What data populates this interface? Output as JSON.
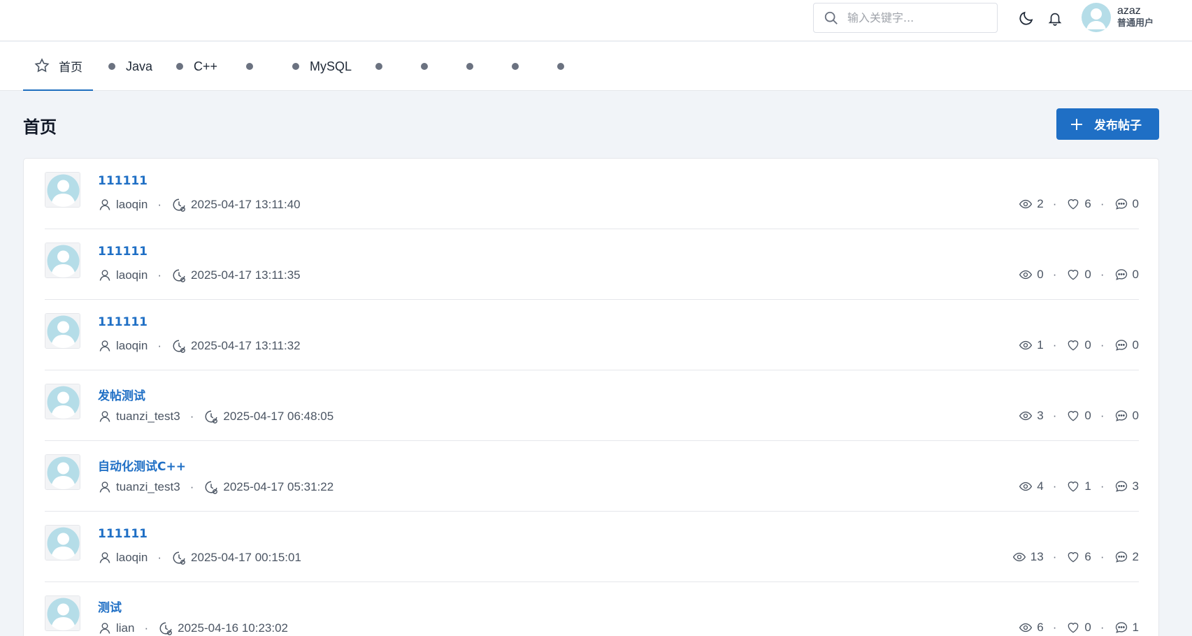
{
  "header": {
    "search_placeholder": "输入关键字...",
    "user": {
      "name": "azaz",
      "role": "普通用户"
    }
  },
  "categories": [
    {
      "label": "首页",
      "active": true
    },
    {
      "label": "Java"
    },
    {
      "label": "C++"
    },
    {
      "label": ""
    },
    {
      "label": "MySQL"
    },
    {
      "label": ""
    },
    {
      "label": ""
    },
    {
      "label": ""
    },
    {
      "label": ""
    },
    {
      "label": ""
    }
  ],
  "page": {
    "title": "首页",
    "publish_label": "发布帖子"
  },
  "posts": [
    {
      "title": "111111",
      "author": "laoqin",
      "time": "2025-04-17 13:11:40",
      "views": "2",
      "likes": "6",
      "comments": "0"
    },
    {
      "title": "111111",
      "author": "laoqin",
      "time": "2025-04-17 13:11:35",
      "views": "0",
      "likes": "0",
      "comments": "0"
    },
    {
      "title": "111111",
      "author": "laoqin",
      "time": "2025-04-17 13:11:32",
      "views": "1",
      "likes": "0",
      "comments": "0"
    },
    {
      "title": "发帖测试",
      "author": "tuanzi_test3",
      "time": "2025-04-17 06:48:05",
      "views": "3",
      "likes": "0",
      "comments": "0"
    },
    {
      "title": "自动化测试C++",
      "author": "tuanzi_test3",
      "time": "2025-04-17 05:31:22",
      "views": "4",
      "likes": "1",
      "comments": "3"
    },
    {
      "title": "111111",
      "author": "laoqin",
      "time": "2025-04-17 00:15:01",
      "views": "13",
      "likes": "6",
      "comments": "2"
    },
    {
      "title": "测试",
      "author": "lian",
      "time": "2025-04-16 10:23:02",
      "views": "6",
      "likes": "0",
      "comments": "1"
    }
  ],
  "colors": {
    "accent": "#1f6fc5",
    "background": "#f1f4f8",
    "avatar": "#b5dde8"
  },
  "icons": [
    "search-icon",
    "moon-icon",
    "bell-icon",
    "star-icon",
    "plus-icon",
    "user-icon",
    "clock-icon",
    "eye-icon",
    "heart-icon",
    "comment-icon"
  ]
}
